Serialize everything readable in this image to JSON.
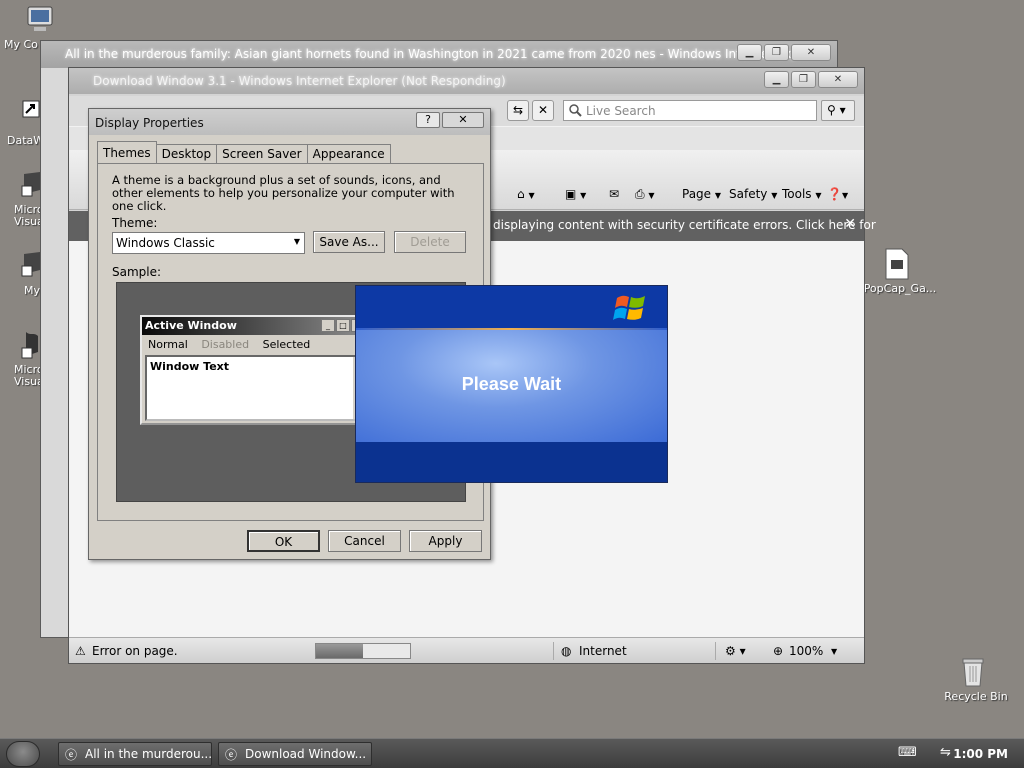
{
  "desktop": {
    "icons": [
      {
        "label": "My Co"
      },
      {
        "label": "DataW"
      },
      {
        "label": "Micro Visua"
      },
      {
        "label": "My"
      },
      {
        "label": "Micro Visua"
      },
      {
        "label": "PopCap_Ga..."
      },
      {
        "label": "Recycle Bin"
      }
    ]
  },
  "ie_back": {
    "title": "All in the murderous family: Asian giant hornets found in Washington in 2021 came from 2020 nes - Windows Internet Expl..."
  },
  "ie": {
    "title": "Download Window 3.1 - Windows Internet Explorer (Not Responding)",
    "search_placeholder": "Live Search",
    "commands": {
      "page": "Page",
      "safety": "Safety",
      "tools": "Tools"
    },
    "infobar_text": "displaying content with security certificate errors. Click here for",
    "status_text": "Error on page.",
    "zone": "Internet",
    "zoom": "100%",
    "progress": 0.5
  },
  "dialog": {
    "title": "Display Properties",
    "tabs": [
      "Themes",
      "Desktop",
      "Screen Saver",
      "Appearance"
    ],
    "description": "A theme is a background plus a set of sounds, icons, and other elements to help you personalize your computer with one click.",
    "theme_label": "Theme:",
    "theme_value": "Windows Classic",
    "save_as": "Save As...",
    "delete": "Delete",
    "sample_label": "Sample:",
    "sample": {
      "active_window": "Active Window",
      "menu_normal": "Normal",
      "menu_disabled": "Disabled",
      "menu_selected": "Selected",
      "window_text": "Window Text"
    },
    "ok": "OK",
    "cancel": "Cancel",
    "apply": "Apply"
  },
  "splash": {
    "message": "Please Wait"
  },
  "taskbar": {
    "buttons": [
      "All in the murderou...",
      "Download Window..."
    ],
    "clock": "1:00 PM"
  },
  "colors": {
    "desktop": "#8a8681",
    "splash_blue": "#0e3aa1",
    "infobar": "#616161"
  }
}
